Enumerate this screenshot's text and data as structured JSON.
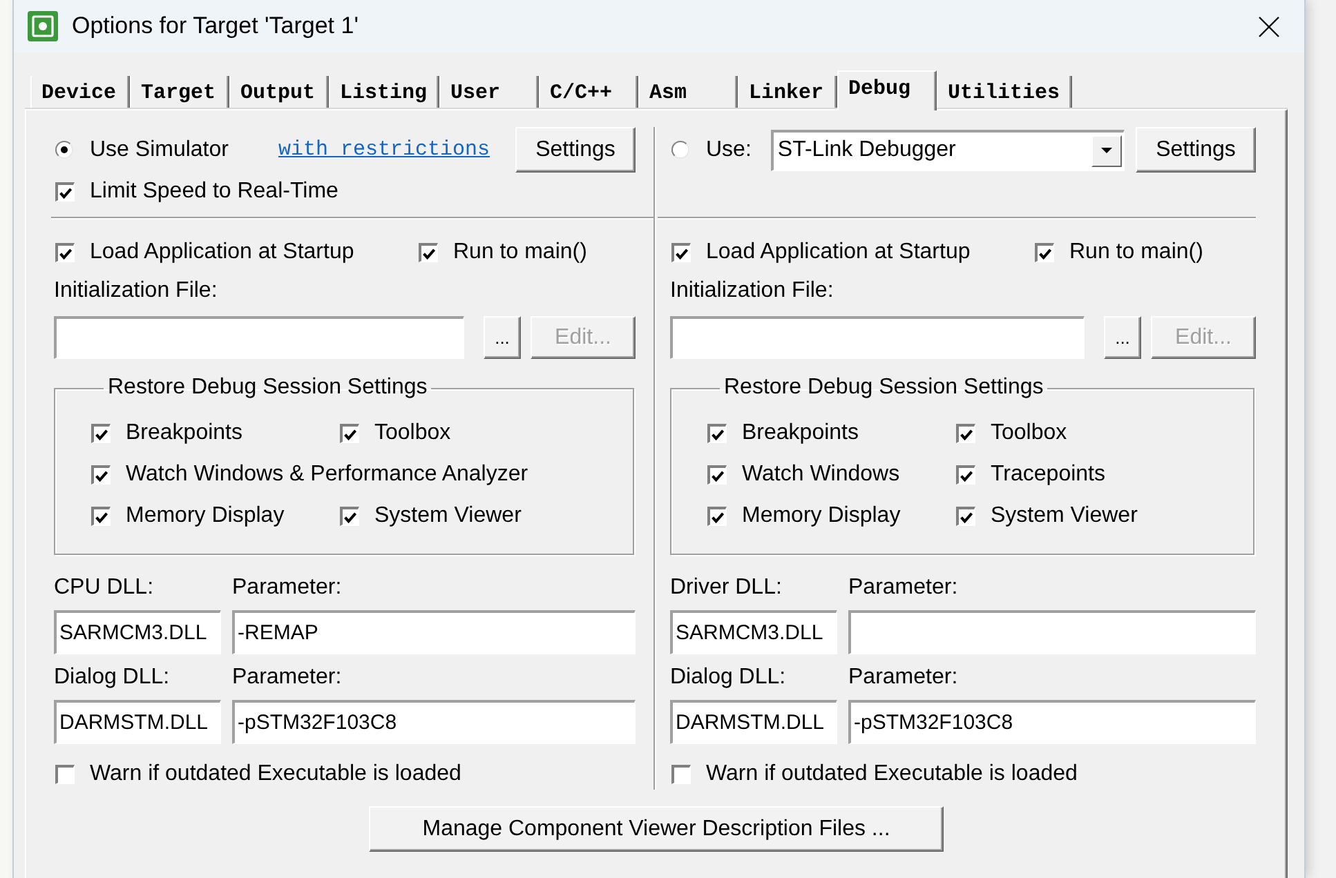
{
  "window": {
    "title": "Options for Target 'Target 1'"
  },
  "tabs": [
    {
      "label": "Device",
      "selected": false
    },
    {
      "label": "Target",
      "selected": false
    },
    {
      "label": "Output",
      "selected": false
    },
    {
      "label": "Listing",
      "selected": false
    },
    {
      "label": "User",
      "selected": false
    },
    {
      "label": "C/C++",
      "selected": false
    },
    {
      "label": "Asm",
      "selected": false
    },
    {
      "label": "Linker",
      "selected": false
    },
    {
      "label": "Debug",
      "selected": true
    },
    {
      "label": "Utilities",
      "selected": false
    }
  ],
  "panels": [
    {
      "debugger": {
        "kind": "simulator",
        "label": "Use Simulator",
        "selected": true,
        "link": "with restrictions",
        "button": "Settings"
      },
      "options": [
        {
          "label": "Limit Speed to Real-Time",
          "checked": true
        }
      ],
      "startup": [
        {
          "label": "Load Application at Startup",
          "checked": true
        },
        {
          "label": "Run to main()",
          "checked": true
        }
      ],
      "init_file": {
        "label": "Initialization File:",
        "browse_button": "...",
        "edit_button": "Edit...",
        "edit_disabled": true
      },
      "restore": {
        "title": "Restore Debug Session Settings",
        "rows": [
          {
            "items": [
              {
                "label": "Breakpoints",
                "checked": true
              },
              {
                "label": "Toolbox",
                "checked": true
              }
            ]
          },
          {
            "items": [
              {
                "label": "Watch Windows & Performance Analyzer",
                "checked": true
              }
            ]
          },
          {
            "items": [
              {
                "label": "Memory Display",
                "checked": true
              },
              {
                "label": "System Viewer",
                "checked": true
              }
            ]
          }
        ]
      },
      "dlls": [
        {
          "label": "CPU DLL:",
          "value": "SARMCM3.DLL",
          "param_label": "Parameter:",
          "param_value": "-REMAP"
        },
        {
          "label": "Dialog DLL:",
          "value": "DARMSTM.DLL",
          "param_label": "Parameter:",
          "param_value": "-pSTM32F103C8"
        }
      ],
      "warn": {
        "label": "Warn if outdated Executable is loaded",
        "checked": false
      }
    },
    {
      "debugger": {
        "kind": "target",
        "label": "Use:",
        "selected": false,
        "value": "ST-Link Debugger",
        "button": "Settings"
      },
      "startup": [
        {
          "label": "Load Application at Startup",
          "checked": true
        },
        {
          "label": "Run to main()",
          "checked": true
        }
      ],
      "init_file": {
        "label": "Initialization File:",
        "browse_button": "...",
        "edit_button": "Edit...",
        "edit_disabled": true
      },
      "restore": {
        "title": "Restore Debug Session Settings",
        "rows": [
          {
            "items": [
              {
                "label": "Breakpoints",
                "checked": true
              },
              {
                "label": "Toolbox",
                "checked": true
              }
            ]
          },
          {
            "items": [
              {
                "label": "Watch Windows",
                "checked": true
              },
              {
                "label": "Tracepoints",
                "checked": true
              }
            ]
          },
          {
            "items": [
              {
                "label": "Memory Display",
                "checked": true
              },
              {
                "label": "System Viewer",
                "checked": true
              }
            ]
          }
        ]
      },
      "dlls": [
        {
          "label": "Driver DLL:",
          "value": "SARMCM3.DLL",
          "param_label": "Parameter:"
        },
        {
          "label": "Dialog DLL:",
          "value": "DARMSTM.DLL",
          "param_label": "Parameter:",
          "param_value": "-pSTM32F103C8"
        }
      ],
      "warn": {
        "label": "Warn if outdated Executable is loaded",
        "checked": false
      }
    }
  ],
  "manage_button": "Manage Component Viewer Description Files ..."
}
